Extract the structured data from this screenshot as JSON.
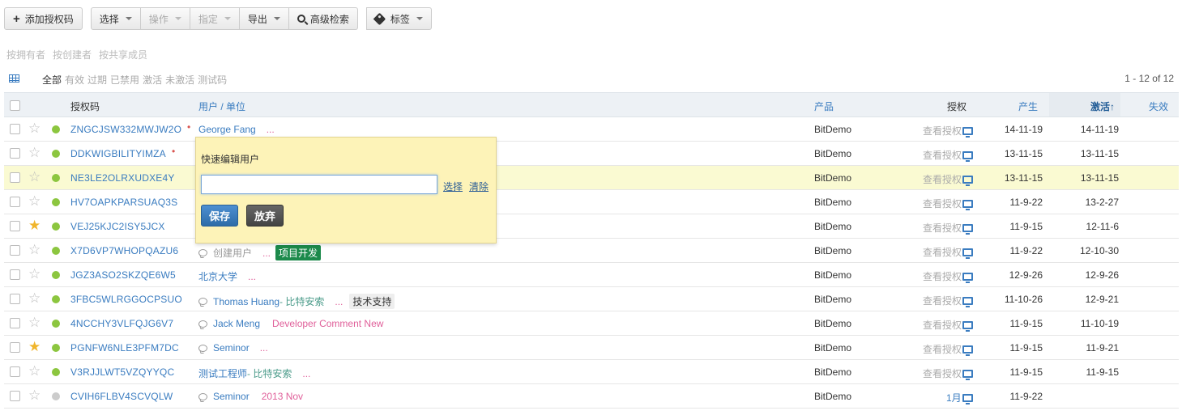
{
  "toolbar": {
    "add_label": "添加授权码",
    "select_label": "选择",
    "operate_label": "操作",
    "assign_label": "指定",
    "export_label": "导出",
    "advanced_search_label": "高级检索",
    "tags_label": "标签"
  },
  "owner_filters": [
    "按拥有者",
    "按创建者",
    "按共享成员"
  ],
  "status_filters": [
    "全部",
    "有效",
    "过期",
    "已禁用",
    "激活",
    "未激活",
    "测试码"
  ],
  "pager": "1 - 12 of  12",
  "columns": {
    "code": "授权码",
    "user": "用户 / 单位",
    "product": "产品",
    "auth": "授权",
    "created": "产生",
    "activated": "激活↑",
    "expired": "失效"
  },
  "rows": [
    {
      "code": "ZNGCJSW332MWJW2O",
      "user": "George Fang",
      "dots": "...",
      "product": "BitDemo",
      "auth": "查看授权",
      "created": "14-11-19",
      "activated": "14-11-19"
    },
    {
      "code": "DDKWIGBILITYIMZA",
      "product": "BitDemo",
      "auth": "查看授权",
      "created": "13-11-15",
      "activated": "13-11-15"
    },
    {
      "code": "NE3LE2OLRXUDXE4Y",
      "product": "BitDemo",
      "auth": "查看授权",
      "created": "13-11-15",
      "activated": "13-11-15"
    },
    {
      "code": "HV7OAPKPARSUAQ3S",
      "product": "BitDemo",
      "auth": "查看授权",
      "created": "11-9-22",
      "activated": "13-2-27"
    },
    {
      "code": "VEJ25KJC2ISY5JCX",
      "product": "BitDemo",
      "auth": "查看授权",
      "created": "11-9-15",
      "activated": "12-11-6"
    },
    {
      "code": "X7D6VP7WHOPQAZU6",
      "user": "创建用户",
      "dots": "...",
      "tag": "项目开发",
      "product": "BitDemo",
      "auth": "查看授权",
      "created": "11-9-22",
      "activated": "12-10-30"
    },
    {
      "code": "JGZ3ASO2SKZQE6W5",
      "user": "北京大学",
      "dots": "...",
      "product": "BitDemo",
      "auth": "查看授权",
      "created": "12-9-26",
      "activated": "12-9-26"
    },
    {
      "code": "3FBC5WLRGGOCPSUO",
      "user": "Thomas Huang",
      "org": " - 比特安索",
      "dots": "...",
      "tag": "技术支持",
      "product": "BitDemo",
      "auth": "查看授权",
      "created": "11-10-26",
      "activated": "12-9-21"
    },
    {
      "code": "4NCCHY3VLFQJG6V7",
      "user": "Jack Meng",
      "comment": "Developer Comment New",
      "product": "BitDemo",
      "auth": "查看授权",
      "created": "11-9-15",
      "activated": "11-10-19"
    },
    {
      "code": "PGNFW6NLE3PFM7DC",
      "user": "Seminor",
      "dots": "...",
      "product": "BitDemo",
      "auth": "查看授权",
      "created": "11-9-15",
      "activated": "11-9-21"
    },
    {
      "code": "V3RJJLWT5VZQYYQC",
      "user": "测试工程师",
      "org": " - 比特安索",
      "dots": "...",
      "product": "BitDemo",
      "auth": "查看授权",
      "created": "11-9-15",
      "activated": "11-9-15"
    },
    {
      "code": "CVIH6FLBV4SCVQLW",
      "user": "Seminor",
      "comment": "2013 Nov",
      "product": "BitDemo",
      "auth": "1月",
      "created": "11-9-22",
      "activated": ""
    }
  ],
  "popup": {
    "title": "快速编辑用户",
    "input_value": "",
    "select_link": "选择",
    "clear_link": "清除",
    "save_label": "保存",
    "cancel_label": "放弃"
  },
  "colors": {
    "link": "#3a7cc0",
    "active_dot": "#8cc63f",
    "favorite_star": "#f0b52c",
    "popup_bg": "#fdf3b8",
    "highlight_row": "#fafad2"
  }
}
